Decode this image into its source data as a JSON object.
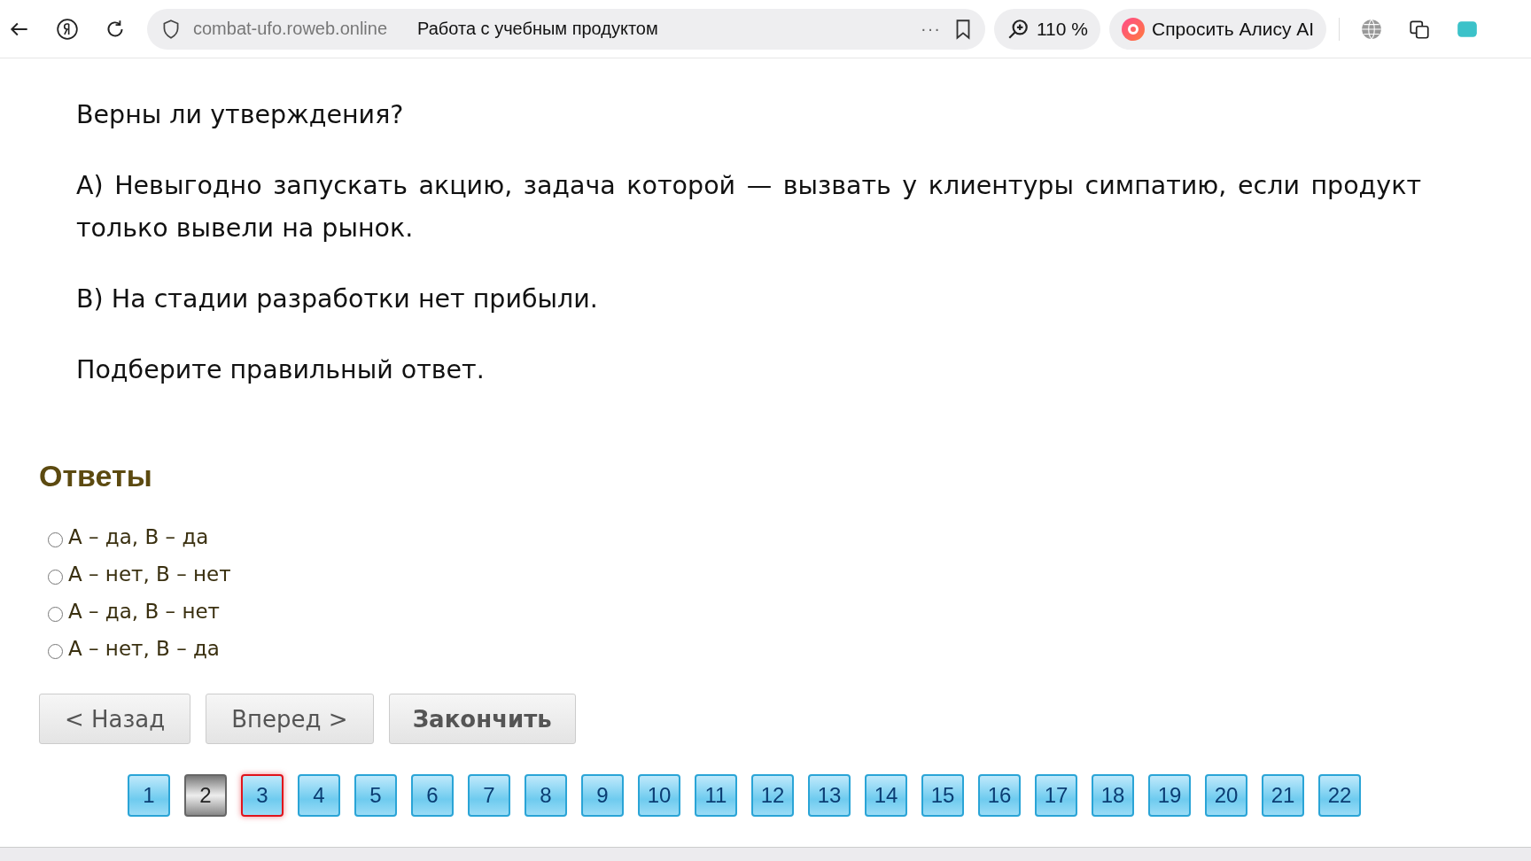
{
  "browser": {
    "url": "combat-ufo.roweb.online",
    "title": "Работа с учебным продуктом",
    "more": "···",
    "zoom": "110 %",
    "assistant": "Спросить Алису AI"
  },
  "question": {
    "paragraphs": [
      "Верны ли утверждения?",
      "А) Невыгодно запускать акцию, задача которой — вызвать у клиентуры симпатию, если продукт только вывели на рынок.",
      "В) На стадии разработки нет прибыли.",
      "Подберите правильный ответ."
    ]
  },
  "answers": {
    "heading": "Ответы",
    "options": [
      {
        "label": "А – да, В – да",
        "selected": false
      },
      {
        "label": "А – нет, В – нет",
        "selected": false
      },
      {
        "label": "А – да, В – нет",
        "selected": false
      },
      {
        "label": "А – нет, В – да",
        "selected": false
      }
    ]
  },
  "buttons": [
    {
      "label": "< Назад",
      "kind": "nav"
    },
    {
      "label": "Вперед >",
      "kind": "nav"
    },
    {
      "label": "Закончить",
      "kind": "finish"
    }
  ],
  "pages": [
    {
      "label": "1",
      "selected": false,
      "visited": false
    },
    {
      "label": "2",
      "selected": false,
      "visited": true
    },
    {
      "label": "3",
      "selected": true,
      "visited": false
    },
    {
      "label": "4",
      "selected": false,
      "visited": false
    },
    {
      "label": "5",
      "selected": false,
      "visited": false
    },
    {
      "label": "6",
      "selected": false,
      "visited": false
    },
    {
      "label": "7",
      "selected": false,
      "visited": false
    },
    {
      "label": "8",
      "selected": false,
      "visited": false
    },
    {
      "label": "9",
      "selected": false,
      "visited": false
    },
    {
      "label": "10",
      "selected": false,
      "visited": false
    },
    {
      "label": "11",
      "selected": false,
      "visited": false
    },
    {
      "label": "12",
      "selected": false,
      "visited": false
    },
    {
      "label": "13",
      "selected": false,
      "visited": false
    },
    {
      "label": "14",
      "selected": false,
      "visited": false
    },
    {
      "label": "15",
      "selected": false,
      "visited": false
    },
    {
      "label": "16",
      "selected": false,
      "visited": false
    },
    {
      "label": "17",
      "selected": false,
      "visited": false
    },
    {
      "label": "18",
      "selected": false,
      "visited": false
    },
    {
      "label": "19",
      "selected": false,
      "visited": false
    },
    {
      "label": "20",
      "selected": false,
      "visited": false
    },
    {
      "label": "21",
      "selected": false,
      "visited": false
    },
    {
      "label": "22",
      "selected": false,
      "visited": false
    }
  ]
}
